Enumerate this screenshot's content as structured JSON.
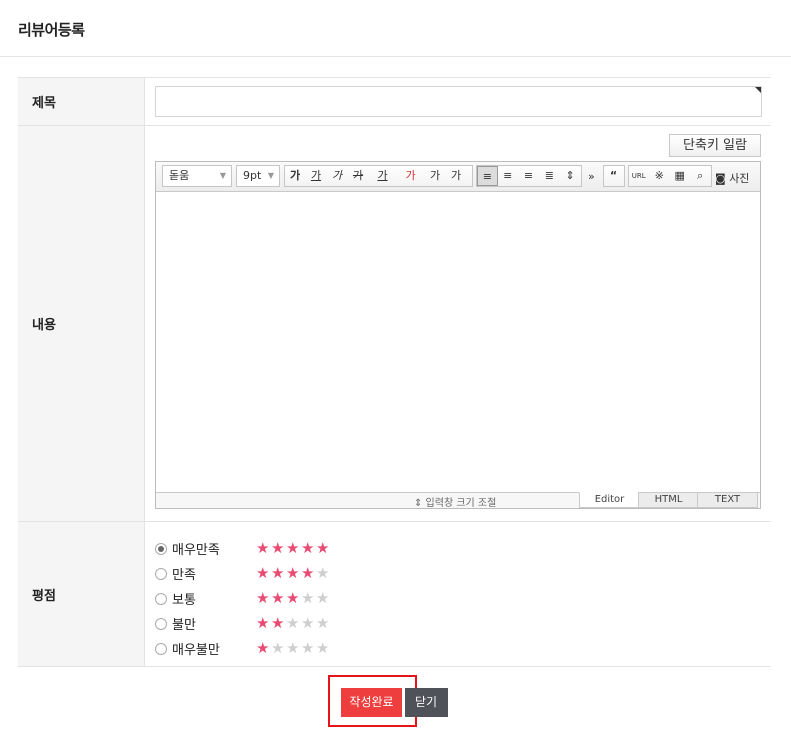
{
  "header": {
    "title": "리뷰어등록"
  },
  "form": {
    "title_label": "제목",
    "title_value": "",
    "content_label": "내용",
    "rating_label": "평점"
  },
  "editor": {
    "shortcut_button": "단축키 일람",
    "font_select": "돋움",
    "size_select": "9pt",
    "format_buttons": [
      "가",
      "가",
      "가",
      "가",
      "가",
      "가",
      "가",
      "가"
    ],
    "align_buttons": [
      "align-left",
      "align-center",
      "align-right",
      "align-justify",
      "line-height"
    ],
    "more": "»",
    "insert_buttons": [
      "“",
      "URL",
      "※",
      "table",
      "search"
    ],
    "photo_label": "사진",
    "resize_label": "⇕ 입력창 크기 조절",
    "modes": [
      "Editor",
      "HTML",
      "TEXT"
    ],
    "active_mode": "Editor"
  },
  "ratings": [
    {
      "label": "매우만족",
      "stars": 5,
      "selected": true
    },
    {
      "label": "만족",
      "stars": 4,
      "selected": false
    },
    {
      "label": "보통",
      "stars": 3,
      "selected": false
    },
    {
      "label": "불만",
      "stars": 2,
      "selected": false
    },
    {
      "label": "매우불만",
      "stars": 1,
      "selected": false
    }
  ],
  "buttons": {
    "submit": "작성완료",
    "close": "닫기"
  },
  "colors": {
    "star_on": "#e94b73",
    "star_off": "#cfcfcf",
    "submit_bg": "#ef3e3e",
    "close_bg": "#505259",
    "highlight_border": "#e5141b"
  }
}
